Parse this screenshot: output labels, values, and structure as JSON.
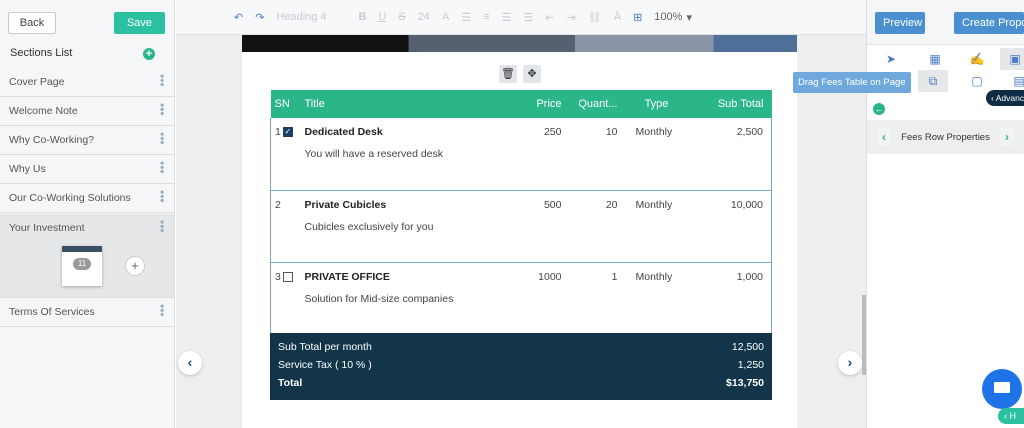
{
  "left": {
    "back": "Back",
    "save": "Save",
    "sections_title": "Sections List",
    "sections": [
      "Cover Page",
      "Welcome Note",
      "Why Co-Working?",
      "Why Us",
      "Our Co-Working Solutions",
      "Your Investment",
      "Terms Of Services"
    ],
    "thumb_page": "11"
  },
  "toolbar": {
    "heading": "Heading 4",
    "font_size": "24",
    "zoom": "100%"
  },
  "table": {
    "headers": [
      "SN",
      "Title",
      "Price",
      "Quant...",
      "Type",
      "Sub Total"
    ],
    "rows": [
      {
        "sn": "1",
        "checked": true,
        "title": "Dedicated Desk",
        "desc": "You will have a reserved desk",
        "price": "250",
        "qty": "10",
        "type": "Monthly",
        "subtotal": "2,500"
      },
      {
        "sn": "2",
        "title": "Private Cubicles",
        "desc": "Cubicles exclusively for you",
        "price": "500",
        "qty": "20",
        "type": "Monthly",
        "subtotal": "10,000"
      },
      {
        "sn": "3",
        "checked": false,
        "title": "PRIVATE OFFICE",
        "desc": "Solution for Mid-size companies",
        "price": "1000",
        "qty": "1",
        "type": "Monthly",
        "subtotal": "1,000"
      }
    ],
    "footer": [
      {
        "label": "Sub Total per month",
        "value": "12,500"
      },
      {
        "label": "Service Tax ( 10 % )",
        "value": "1,250"
      },
      {
        "label": "Total",
        "value": "$13,750"
      }
    ]
  },
  "right": {
    "preview": "Preview",
    "create": "Create Proposal",
    "tooltip": "Drag Fees Table on Page",
    "advanced": "Advanced",
    "properties": "Fees Row Properties",
    "help": "H"
  },
  "colors": {
    "accent": "#2bb68a",
    "dark": "#12354a",
    "primary": "#4a90d0"
  }
}
